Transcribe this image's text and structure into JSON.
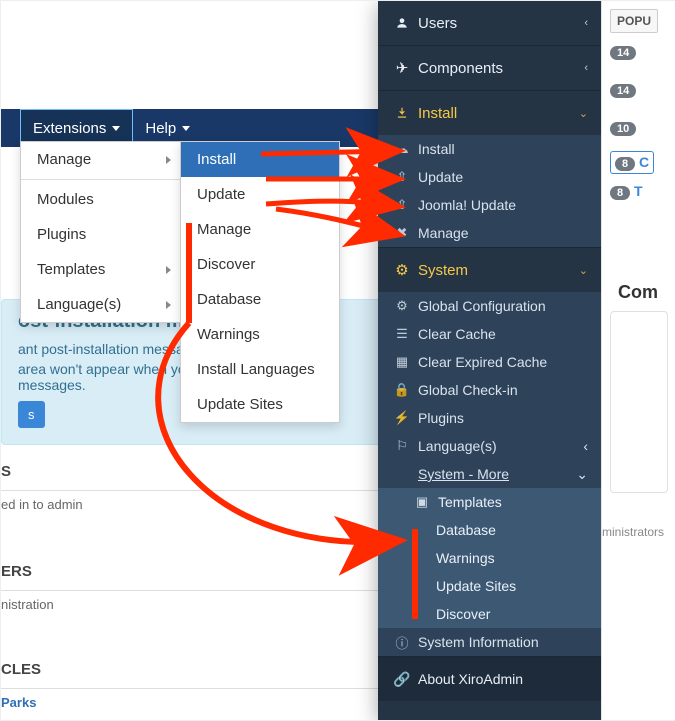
{
  "old_menu": {
    "extensions": "Extensions",
    "help": "Help",
    "dropdown1": {
      "manage": "Manage",
      "modules": "Modules",
      "plugins": "Plugins",
      "templates": "Templates",
      "languages": "Language(s)"
    },
    "dropdown2": {
      "install": "Install",
      "update": "Update",
      "manage": "Manage",
      "discover": "Discover",
      "database": "Database",
      "warnings": "Warnings",
      "install_langs": "Install Languages",
      "update_sites": "Update Sites"
    }
  },
  "bg": {
    "heading": "ost-installation messa",
    "line1": "ant post-installation messages ",
    "line2": "area won't appear when you have hidden all the messages.",
    "button": "s",
    "sec_s": "S",
    "sec_s_sub": "ed in to admin",
    "sec_ers": "ERS",
    "sec_ers_sub": "nistration",
    "sec_cles": "CLES",
    "sec_cles_link": " Parks"
  },
  "side": {
    "users": "Users",
    "components": "Components",
    "install": "Install",
    "install_items": {
      "install": "Install",
      "update": "Update",
      "joomla_update": "Joomla! Update",
      "manage": "Manage"
    },
    "system": "System",
    "system_items": {
      "global_config": "Global Configuration",
      "clear_cache": "Clear Cache",
      "clear_exp_cache": "Clear Expired Cache",
      "global_checkin": "Global Check-in",
      "plugins": "Plugins",
      "languages": "Language(s)",
      "system_more": "System - More",
      "more": {
        "templates": "Templates",
        "database": "Database",
        "warnings": "Warnings",
        "update_sites": "Update Sites",
        "discover": "Discover"
      },
      "system_info": "System Information"
    },
    "about": "About XiroAdmin"
  },
  "rstrip": {
    "popu": "POPU",
    "b1": "14",
    "b2": "14",
    "b3": "10",
    "b4": "8",
    "b4_suffix": "C",
    "b5": "8",
    "b5_suffix": "T",
    "com": "Com",
    "admins": "ministrators"
  }
}
